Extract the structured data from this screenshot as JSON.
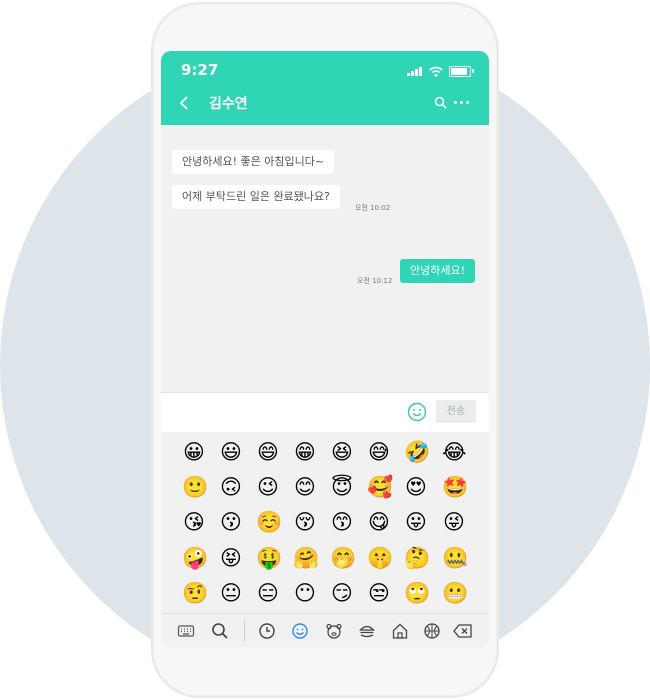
{
  "status": {
    "time": "9:27"
  },
  "header": {
    "title": "김수연",
    "back_icon": "chevron-left-icon",
    "search_icon": "search-icon",
    "more_icon": "more-dots-icon",
    "color": "#2fd5b4"
  },
  "messages": [
    {
      "direction": "in",
      "text": "안녕하세요! 좋은 아침입니다~",
      "time": ""
    },
    {
      "direction": "in",
      "text": "어제 부탁드린 일은 완료됐나요?",
      "time": "오전 10:02"
    },
    {
      "direction": "out",
      "text": "안녕하세요!",
      "time": "오전 10:12"
    }
  ],
  "composer": {
    "value": "",
    "placeholder": "",
    "send_label": "전송",
    "emoji_icon": "smiley-icon"
  },
  "emoji_grid": [
    [
      "😀",
      "😃",
      "😄",
      "😁",
      "😆",
      "😅",
      "🤣",
      "😂"
    ],
    [
      "🙂",
      "🙃",
      "😉",
      "😊",
      "😇",
      "🥰",
      "😍",
      "🤩"
    ],
    [
      "😘",
      "😗",
      "☺️",
      "😚",
      "😙",
      "😋",
      "😛",
      "😜"
    ],
    [
      "🤪",
      "😝",
      "🤑",
      "🤗",
      "🤭",
      "🤫",
      "🤔",
      "🤐"
    ],
    [
      "🤨",
      "😐",
      "😑",
      "😶",
      "😏",
      "😒",
      "🙄",
      "😬"
    ]
  ],
  "emoji_tabs": [
    "keyboard-icon",
    "search-icon",
    "recent-clock-icon",
    "smiley-tab-icon",
    "animal-icon",
    "food-icon",
    "building-icon",
    "sports-ball-icon",
    "backspace-icon"
  ],
  "active_tab": "smiley-tab-icon"
}
